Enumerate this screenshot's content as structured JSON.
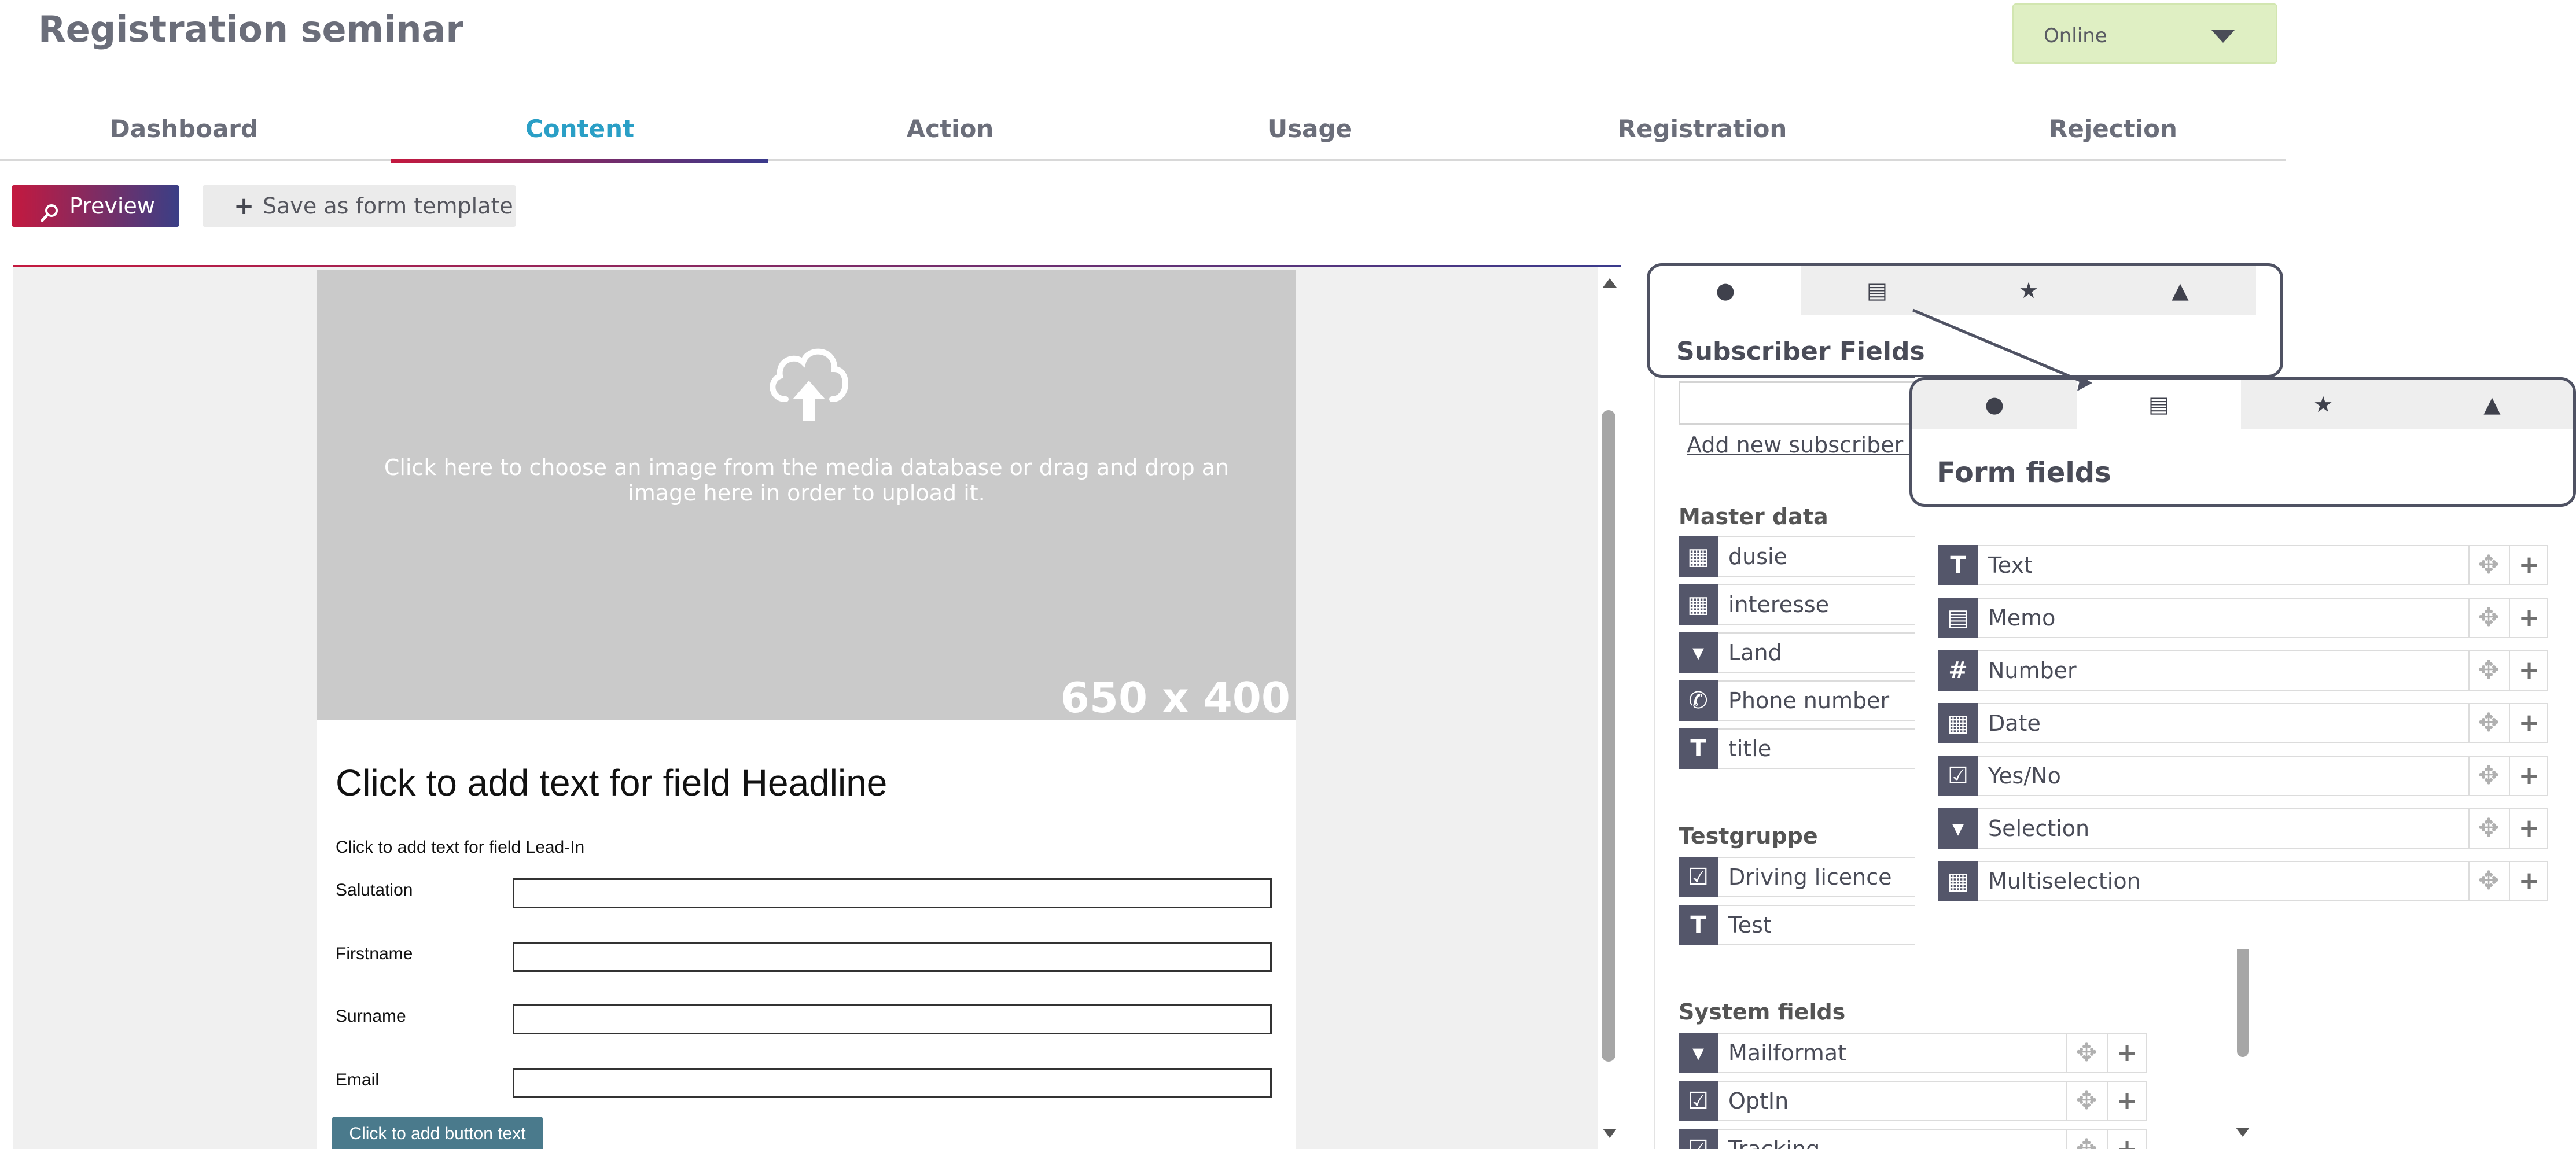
{
  "header": {
    "title": "Registration seminar",
    "status_select": {
      "value": "Online"
    }
  },
  "nav": {
    "tabs": [
      {
        "label": "Dashboard"
      },
      {
        "label": "Content"
      },
      {
        "label": "Action"
      },
      {
        "label": "Usage"
      },
      {
        "label": "Registration"
      },
      {
        "label": "Rejection"
      }
    ],
    "active": "Content"
  },
  "toolbar": {
    "preview_label": "Preview",
    "save_template_label": "Save as form template"
  },
  "editor": {
    "image_hint": "Click here to choose an image from the media database or drag and drop an image here in order to upload it.",
    "image_size": "650 x 400",
    "headline": "Click to add text for field Headline",
    "lead_in": "Click to add text for field Lead-In",
    "fields": [
      {
        "label": "Salutation"
      },
      {
        "label": "Firstname"
      },
      {
        "label": "Surname"
      },
      {
        "label": "Email"
      }
    ],
    "button_text": "Click to add button text"
  },
  "subscriber_panel": {
    "title": "Subscriber Fields",
    "add_link": "Add new subscriber f",
    "groups": [
      {
        "title": "Master data",
        "items": [
          {
            "label": "dusie",
            "icon": "table-icon"
          },
          {
            "label": "interesse",
            "icon": "table-icon"
          },
          {
            "label": "Land",
            "icon": "dropdown-icon"
          },
          {
            "label": "Phone number",
            "icon": "phone-icon"
          },
          {
            "label": "title",
            "icon": "text-icon"
          }
        ]
      },
      {
        "title": "Testgruppe",
        "items": [
          {
            "label": "Driving licence",
            "icon": "checkbox-icon"
          },
          {
            "label": "Test",
            "icon": "text-icon"
          }
        ]
      },
      {
        "title": "System fields",
        "items": [
          {
            "label": "Mailformat",
            "icon": "dropdown-icon"
          },
          {
            "label": "OptIn",
            "icon": "checkbox-icon"
          },
          {
            "label": "Tracking",
            "icon": "checkbox-icon"
          }
        ]
      }
    ]
  },
  "form_fields_panel": {
    "title": "Form fields",
    "items": [
      {
        "label": "Text",
        "icon": "text-icon"
      },
      {
        "label": "Memo",
        "icon": "memo-icon"
      },
      {
        "label": "Number",
        "icon": "hash-icon"
      },
      {
        "label": "Date",
        "icon": "calendar-icon"
      },
      {
        "label": "Yes/No",
        "icon": "checkbox-icon"
      },
      {
        "label": "Selection",
        "icon": "dropdown-icon"
      },
      {
        "label": "Multiselection",
        "icon": "table-icon"
      }
    ]
  },
  "side_tabs": [
    {
      "icon": "user-icon"
    },
    {
      "icon": "form-icon"
    },
    {
      "icon": "star-icon"
    },
    {
      "icon": "stamp-icon"
    }
  ],
  "colors": {
    "accent_start": "#c4193f",
    "accent_end": "#3a3a8c",
    "active_tab": "#2a9fc6",
    "status_bg": "#dfefc3",
    "field_icon_bg": "#54566a"
  }
}
